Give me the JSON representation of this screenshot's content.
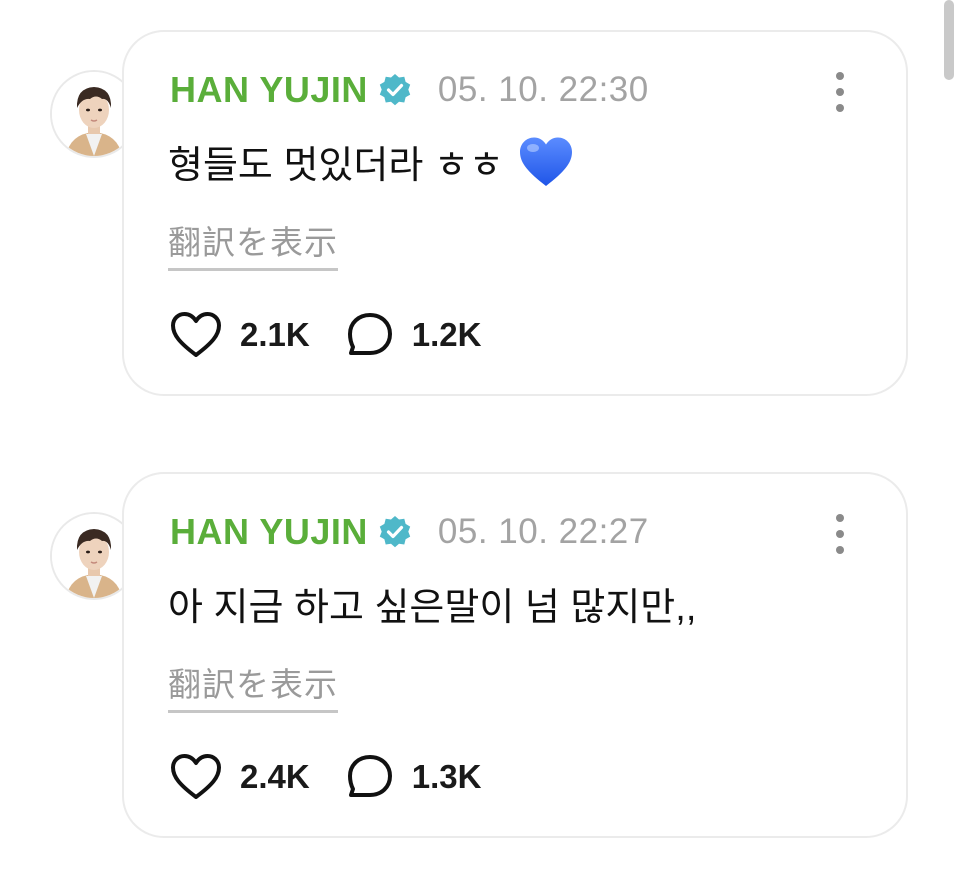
{
  "posts": [
    {
      "author": "HAN YUJIN",
      "timestamp": "05. 10. 22:30",
      "text": "형들도 멋있더라 ㅎㅎ",
      "emoji": "blue-heart",
      "translate_label": "翻訳を表示",
      "likes": "2.1K",
      "comments": "1.2K"
    },
    {
      "author": "HAN YUJIN",
      "timestamp": "05. 10. 22:27",
      "text": "아 지금 하고 싶은말이 넘 많지만,,",
      "translate_label": "翻訳を表示",
      "likes": "2.4K",
      "comments": "1.3K"
    }
  ],
  "colors": {
    "author_name": "#5aae3a",
    "verified_badge": "#4fb8c9",
    "timestamp": "#a3a3a3",
    "heart_emoji": "#2f6bff"
  }
}
